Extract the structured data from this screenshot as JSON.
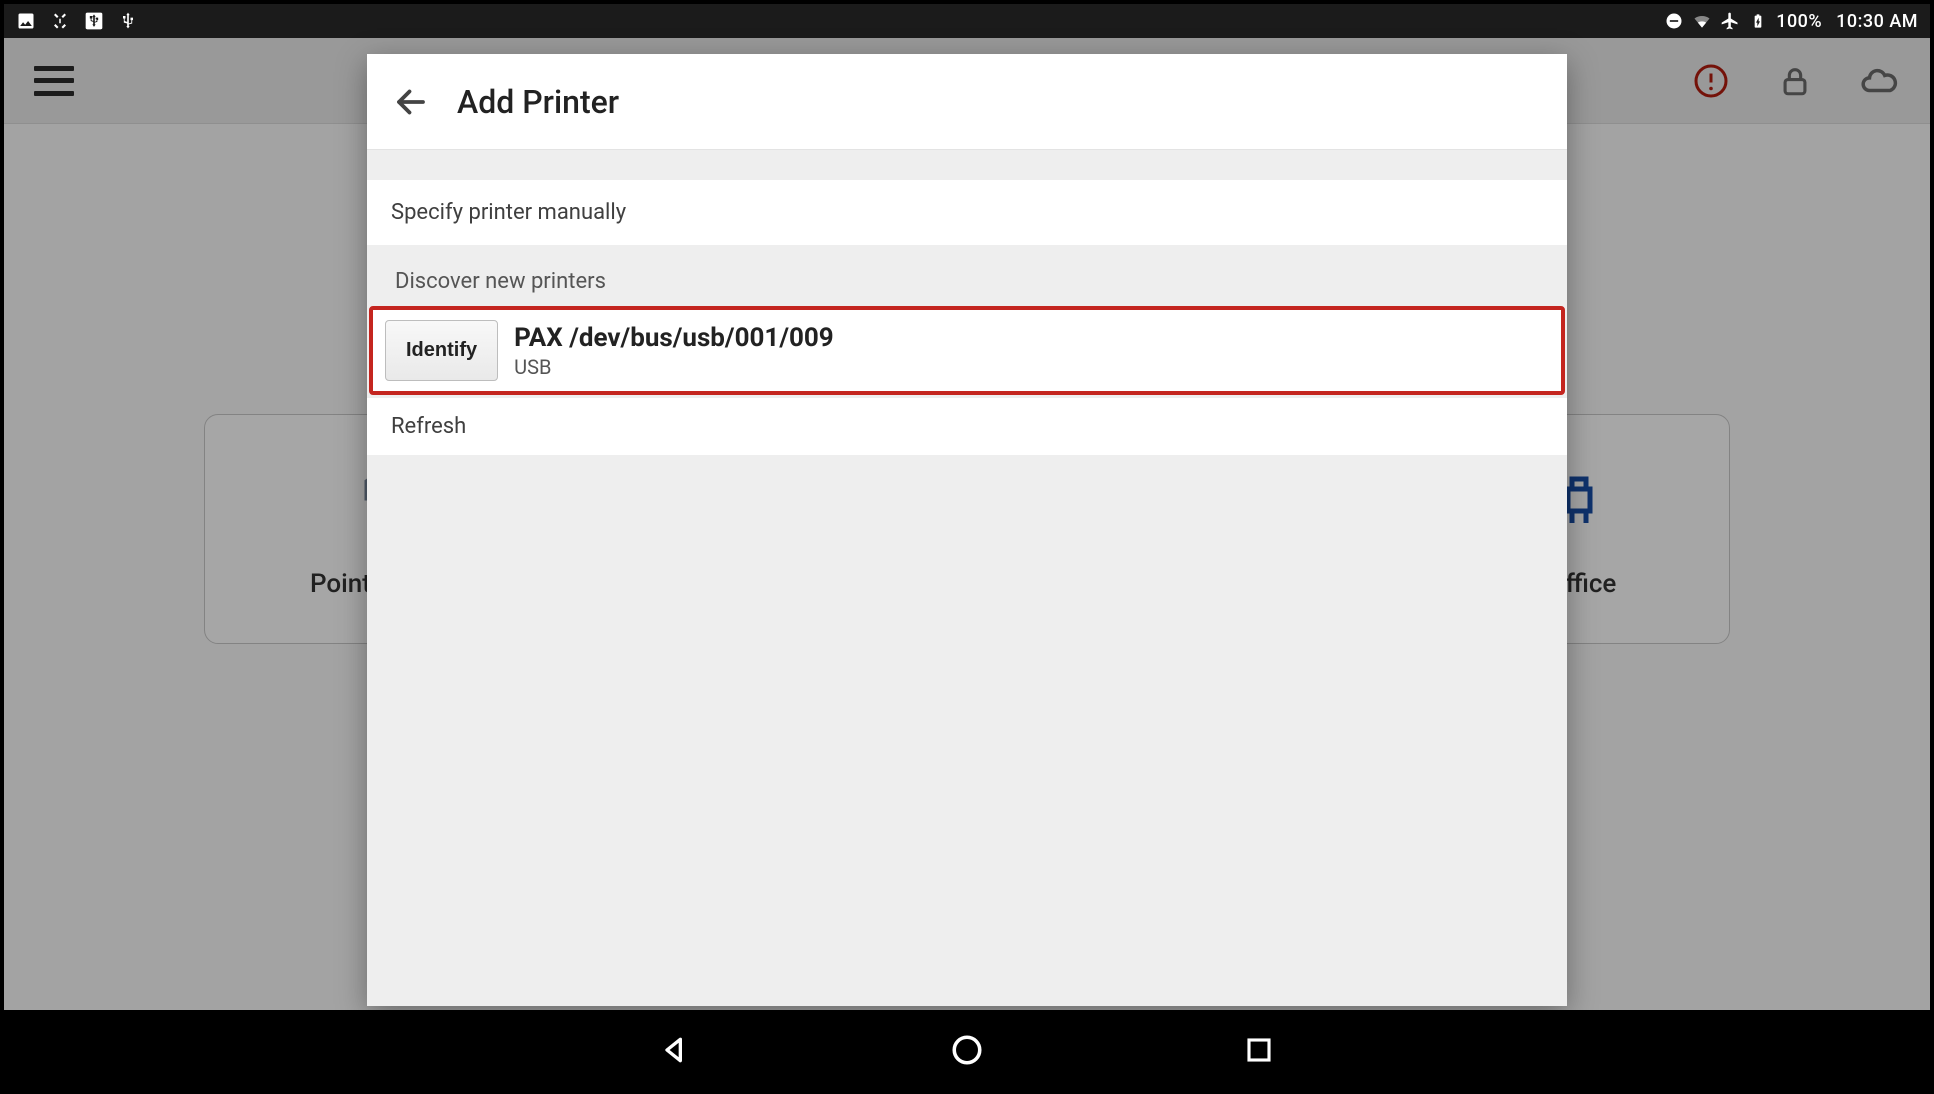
{
  "status_bar": {
    "battery_percent": "100%",
    "time": "10:30 AM"
  },
  "app_bar": {},
  "tiles": {
    "left_label": "Point of Sale",
    "right_label": "Back Office"
  },
  "dialog": {
    "title": "Add Printer",
    "specify_manual_label": "Specify printer manually",
    "discover_header": "Discover new printers",
    "identify_label": "Identify",
    "printer_name": "PAX /dev/bus/usb/001/009",
    "printer_connection": "USB",
    "refresh_label": "Refresh"
  }
}
